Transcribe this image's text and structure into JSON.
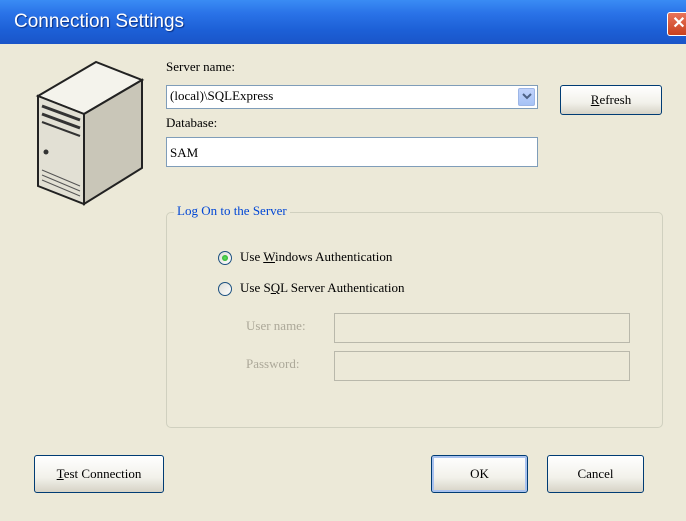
{
  "window": {
    "title": "Connection Settings",
    "close_symbol": "✕"
  },
  "server": {
    "label": "Server name:",
    "value": "(local)\\SQLExpress",
    "refresh_prefix": "",
    "refresh_mnemonic": "R",
    "refresh_rest": "efresh"
  },
  "database": {
    "label": "Database:",
    "value": "SAM"
  },
  "logon": {
    "group_title": "Log On to the Server",
    "windows_auth": {
      "prefix": "Use ",
      "mnemonic": "W",
      "rest": "indows Authentication",
      "selected": true
    },
    "sql_auth": {
      "prefix": "Use S",
      "mnemonic": "Q",
      "rest": "L Server Authentication",
      "selected": false
    },
    "username_label": "User name:",
    "password_label": "Password:",
    "username_value": "",
    "password_value": ""
  },
  "buttons": {
    "test_mnemonic": "T",
    "test_rest": "est Connection",
    "ok": "OK",
    "cancel": "Cancel"
  },
  "icons": {
    "server": "server-tower-icon",
    "dropdown": "chevron-down-icon"
  }
}
